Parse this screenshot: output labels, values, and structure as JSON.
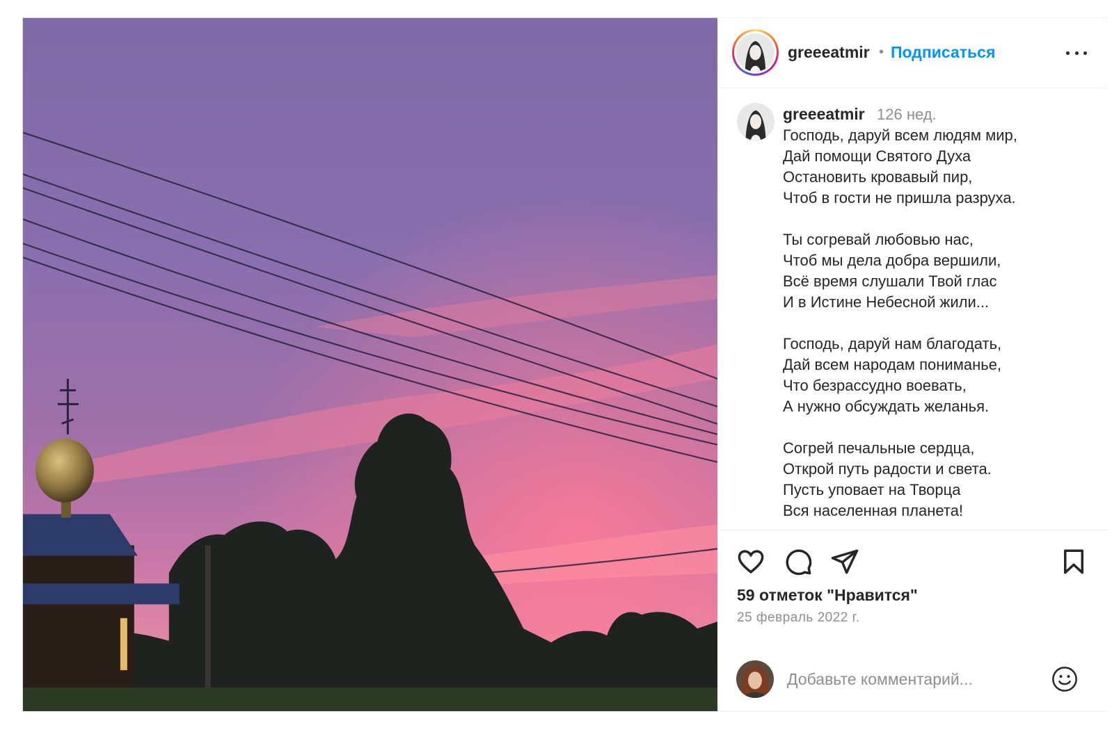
{
  "post": {
    "author": "greeeatmir",
    "follow_label": "Подписаться",
    "separator": "•",
    "time_ago": "126 нед.",
    "caption_lines": [
      "Господь, даруй всем людям мир,",
      "Дай помощи Святого Духа",
      "Остановить кровавый пир,",
      "Чтоб в гости не пришла разруха.",
      "",
      "Ты согревай любовью нас,",
      "Чтоб мы дела добра вершили,",
      "Всё время слушали Твой глас",
      "И в Истине Небесной жили...",
      "",
      "Господь, даруй нам благодать,",
      "Дай всем народам пониманье,",
      "Что безрассудно воевать,",
      "А нужно обсуждать желанья.",
      "",
      "Согрей печальные сердца,",
      "Открой путь радости и света.",
      "Пусть уповает на Творца",
      "Вся населенная планета!"
    ],
    "likes_text": "59 отметок \"Нравится\"",
    "date_text": "25 февраль 2022 г."
  },
  "comment": {
    "placeholder": "Добавьте комментарий..."
  },
  "icons": {
    "like": "heart-icon",
    "comment": "comment-icon",
    "share": "paper-plane-icon",
    "save": "bookmark-icon",
    "emoji": "smiley-icon",
    "more": "more-dots-icon"
  },
  "colors": {
    "accent": "#0095f6",
    "text": "#262626",
    "muted": "#8e8e8e",
    "border": "#efefef"
  }
}
